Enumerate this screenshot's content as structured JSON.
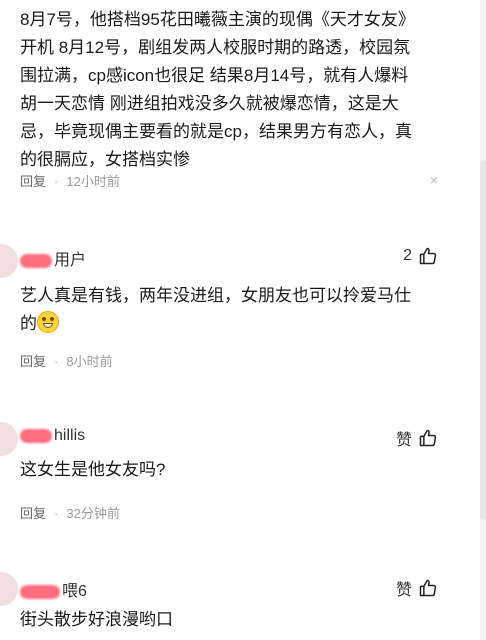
{
  "comments": [
    {
      "text_lines": [
        "8月7号，他搭档95花田曦薇主演的现偶《天才女友》",
        "开机 8月12号，剧组发两人校服时期的路透，校园氛",
        "围拉满，cp感icon也很足 结果8月14号，就有人爆料",
        "胡一天恋情 刚进组拍戏没多久就被爆恋情，这是大",
        "忌，毕竟现偶主要看的就是cp，结果男方有恋人，真",
        "的很膈应，女搭档实惨"
      ],
      "reply": "回复",
      "time": "12小时前",
      "close": "×"
    },
    {
      "username": "用户",
      "like": "2",
      "text_lines": [
        "艺人真是有钱，两年没进组，女朋友也可以拎爱马仕",
        "的"
      ],
      "reply": "回复",
      "time": "8小时前"
    },
    {
      "username": "hillis",
      "like": "赞",
      "text_lines": [
        "这女生是他女友吗?"
      ],
      "reply": "回复",
      "time": "32分钟前"
    },
    {
      "username": "喂6",
      "like": "赞",
      "text_lines": [
        "街头散步好浪漫哟口"
      ]
    }
  ],
  "icons": {
    "like": "thumbs-up-icon",
    "emoji": "grinning-face-icon",
    "close": "close-icon"
  }
}
